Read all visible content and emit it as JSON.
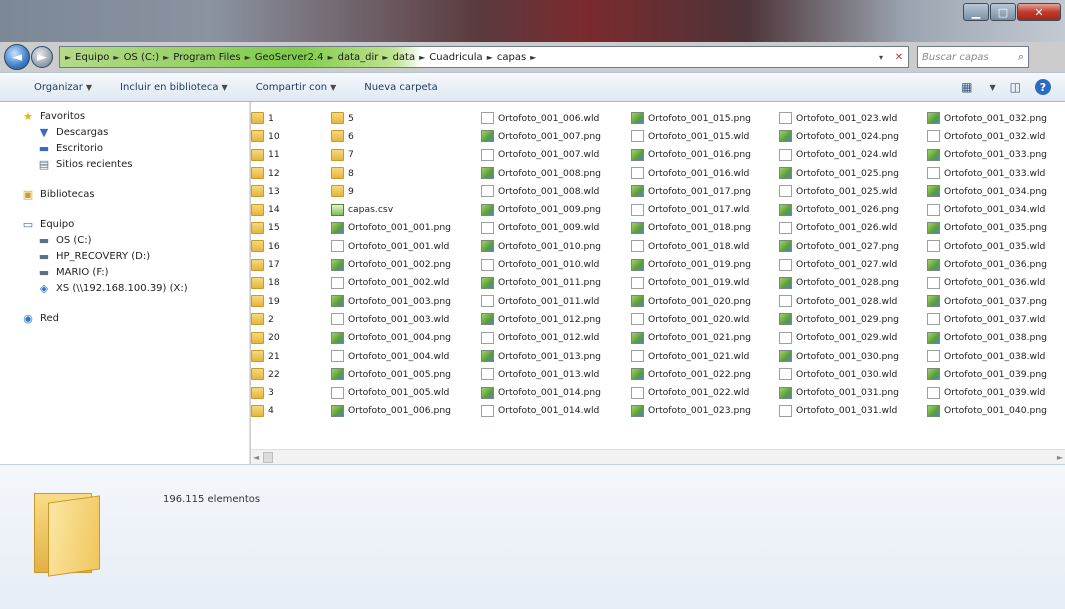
{
  "window": {
    "controls": {
      "minimize": "▁",
      "maximize": "□",
      "close": "✕"
    }
  },
  "nav": {
    "back_icon": "◄",
    "forward_icon": "►",
    "breadcrumb": [
      "Equipo",
      "OS (C:)",
      "Program Files",
      "GeoServer2.4",
      "data_dir",
      "data",
      "Cuadricula",
      "capas"
    ],
    "search_placeholder": "Buscar capas",
    "refresh_icon": "✕",
    "dropdown_icon": "▾"
  },
  "toolbar": {
    "organize": "Organizar",
    "include_library": "Incluir en biblioteca",
    "share_with": "Compartir con",
    "new_folder": "Nueva carpeta",
    "view_icon": "▦",
    "preview_icon": "◫",
    "help_icon": "?"
  },
  "navpane": {
    "favorites": {
      "label": "Favoritos",
      "items": [
        "Descargas",
        "Escritorio",
        "Sitios recientes"
      ]
    },
    "libraries": {
      "label": "Bibliotecas"
    },
    "computer": {
      "label": "Equipo",
      "items": [
        "OS (C:)",
        "HP_RECOVERY (D:)",
        "MARIO (F:)",
        "XS (\\\\192.168.100.39) (X:)"
      ]
    },
    "network": {
      "label": "Red"
    }
  },
  "files": {
    "columns": [
      [
        {
          "name": "1",
          "type": "folder"
        },
        {
          "name": "10",
          "type": "folder"
        },
        {
          "name": "11",
          "type": "folder"
        },
        {
          "name": "12",
          "type": "folder"
        },
        {
          "name": "13",
          "type": "folder"
        },
        {
          "name": "14",
          "type": "folder"
        },
        {
          "name": "15",
          "type": "folder"
        },
        {
          "name": "16",
          "type": "folder"
        },
        {
          "name": "17",
          "type": "folder"
        },
        {
          "name": "18",
          "type": "folder"
        },
        {
          "name": "19",
          "type": "folder"
        },
        {
          "name": "2",
          "type": "folder"
        },
        {
          "name": "20",
          "type": "folder"
        },
        {
          "name": "21",
          "type": "folder"
        },
        {
          "name": "22",
          "type": "folder"
        },
        {
          "name": "3",
          "type": "folder"
        },
        {
          "name": "4",
          "type": "folder"
        }
      ],
      [
        {
          "name": "5",
          "type": "folder"
        },
        {
          "name": "6",
          "type": "folder"
        },
        {
          "name": "7",
          "type": "folder"
        },
        {
          "name": "8",
          "type": "folder"
        },
        {
          "name": "9",
          "type": "folder"
        },
        {
          "name": "capas.csv",
          "type": "csv"
        },
        {
          "name": "Ortofoto_001_001.png",
          "type": "png"
        },
        {
          "name": "Ortofoto_001_001.wld",
          "type": "wld"
        },
        {
          "name": "Ortofoto_001_002.png",
          "type": "png"
        },
        {
          "name": "Ortofoto_001_002.wld",
          "type": "wld"
        },
        {
          "name": "Ortofoto_001_003.png",
          "type": "png"
        },
        {
          "name": "Ortofoto_001_003.wld",
          "type": "wld"
        },
        {
          "name": "Ortofoto_001_004.png",
          "type": "png"
        },
        {
          "name": "Ortofoto_001_004.wld",
          "type": "wld"
        },
        {
          "name": "Ortofoto_001_005.png",
          "type": "png"
        },
        {
          "name": "Ortofoto_001_005.wld",
          "type": "wld"
        },
        {
          "name": "Ortofoto_001_006.png",
          "type": "png"
        }
      ],
      [
        {
          "name": "Ortofoto_001_006.wld",
          "type": "wld"
        },
        {
          "name": "Ortofoto_001_007.png",
          "type": "png"
        },
        {
          "name": "Ortofoto_001_007.wld",
          "type": "wld"
        },
        {
          "name": "Ortofoto_001_008.png",
          "type": "png"
        },
        {
          "name": "Ortofoto_001_008.wld",
          "type": "wld"
        },
        {
          "name": "Ortofoto_001_009.png",
          "type": "png"
        },
        {
          "name": "Ortofoto_001_009.wld",
          "type": "wld"
        },
        {
          "name": "Ortofoto_001_010.png",
          "type": "png"
        },
        {
          "name": "Ortofoto_001_010.wld",
          "type": "wld"
        },
        {
          "name": "Ortofoto_001_011.png",
          "type": "png"
        },
        {
          "name": "Ortofoto_001_011.wld",
          "type": "wld"
        },
        {
          "name": "Ortofoto_001_012.png",
          "type": "png"
        },
        {
          "name": "Ortofoto_001_012.wld",
          "type": "wld"
        },
        {
          "name": "Ortofoto_001_013.png",
          "type": "png"
        },
        {
          "name": "Ortofoto_001_013.wld",
          "type": "wld"
        },
        {
          "name": "Ortofoto_001_014.png",
          "type": "png"
        },
        {
          "name": "Ortofoto_001_014.wld",
          "type": "wld"
        }
      ],
      [
        {
          "name": "Ortofoto_001_015.png",
          "type": "png"
        },
        {
          "name": "Ortofoto_001_015.wld",
          "type": "wld"
        },
        {
          "name": "Ortofoto_001_016.png",
          "type": "png"
        },
        {
          "name": "Ortofoto_001_016.wld",
          "type": "wld"
        },
        {
          "name": "Ortofoto_001_017.png",
          "type": "png"
        },
        {
          "name": "Ortofoto_001_017.wld",
          "type": "wld"
        },
        {
          "name": "Ortofoto_001_018.png",
          "type": "png"
        },
        {
          "name": "Ortofoto_001_018.wld",
          "type": "wld"
        },
        {
          "name": "Ortofoto_001_019.png",
          "type": "png"
        },
        {
          "name": "Ortofoto_001_019.wld",
          "type": "wld"
        },
        {
          "name": "Ortofoto_001_020.png",
          "type": "png"
        },
        {
          "name": "Ortofoto_001_020.wld",
          "type": "wld"
        },
        {
          "name": "Ortofoto_001_021.png",
          "type": "png"
        },
        {
          "name": "Ortofoto_001_021.wld",
          "type": "wld"
        },
        {
          "name": "Ortofoto_001_022.png",
          "type": "png"
        },
        {
          "name": "Ortofoto_001_022.wld",
          "type": "wld"
        },
        {
          "name": "Ortofoto_001_023.png",
          "type": "png"
        }
      ],
      [
        {
          "name": "Ortofoto_001_023.wld",
          "type": "wld"
        },
        {
          "name": "Ortofoto_001_024.png",
          "type": "png"
        },
        {
          "name": "Ortofoto_001_024.wld",
          "type": "wld"
        },
        {
          "name": "Ortofoto_001_025.png",
          "type": "png"
        },
        {
          "name": "Ortofoto_001_025.wld",
          "type": "wld"
        },
        {
          "name": "Ortofoto_001_026.png",
          "type": "png"
        },
        {
          "name": "Ortofoto_001_026.wld",
          "type": "wld"
        },
        {
          "name": "Ortofoto_001_027.png",
          "type": "png"
        },
        {
          "name": "Ortofoto_001_027.wld",
          "type": "wld"
        },
        {
          "name": "Ortofoto_001_028.png",
          "type": "png"
        },
        {
          "name": "Ortofoto_001_028.wld",
          "type": "wld"
        },
        {
          "name": "Ortofoto_001_029.png",
          "type": "png"
        },
        {
          "name": "Ortofoto_001_029.wld",
          "type": "wld"
        },
        {
          "name": "Ortofoto_001_030.png",
          "type": "png"
        },
        {
          "name": "Ortofoto_001_030.wld",
          "type": "wld"
        },
        {
          "name": "Ortofoto_001_031.png",
          "type": "png"
        },
        {
          "name": "Ortofoto_001_031.wld",
          "type": "wld"
        }
      ],
      [
        {
          "name": "Ortofoto_001_032.png",
          "type": "png"
        },
        {
          "name": "Ortofoto_001_032.wld",
          "type": "wld"
        },
        {
          "name": "Ortofoto_001_033.png",
          "type": "png"
        },
        {
          "name": "Ortofoto_001_033.wld",
          "type": "wld"
        },
        {
          "name": "Ortofoto_001_034.png",
          "type": "png"
        },
        {
          "name": "Ortofoto_001_034.wld",
          "type": "wld"
        },
        {
          "name": "Ortofoto_001_035.png",
          "type": "png"
        },
        {
          "name": "Ortofoto_001_035.wld",
          "type": "wld"
        },
        {
          "name": "Ortofoto_001_036.png",
          "type": "png"
        },
        {
          "name": "Ortofoto_001_036.wld",
          "type": "wld"
        },
        {
          "name": "Ortofoto_001_037.png",
          "type": "png"
        },
        {
          "name": "Ortofoto_001_037.wld",
          "type": "wld"
        },
        {
          "name": "Ortofoto_001_038.png",
          "type": "png"
        },
        {
          "name": "Ortofoto_001_038.wld",
          "type": "wld"
        },
        {
          "name": "Ortofoto_001_039.png",
          "type": "png"
        },
        {
          "name": "Ortofoto_001_039.wld",
          "type": "wld"
        },
        {
          "name": "Ortofoto_001_040.png",
          "type": "png"
        }
      ]
    ]
  },
  "scroll": {
    "left_icon": "◄",
    "right_icon": "►"
  },
  "details": {
    "count": "196.115 elementos"
  },
  "colors": {
    "accent": "#1e395b",
    "address_highlight": "#7fcc4a",
    "folder": "#f0c65c"
  }
}
